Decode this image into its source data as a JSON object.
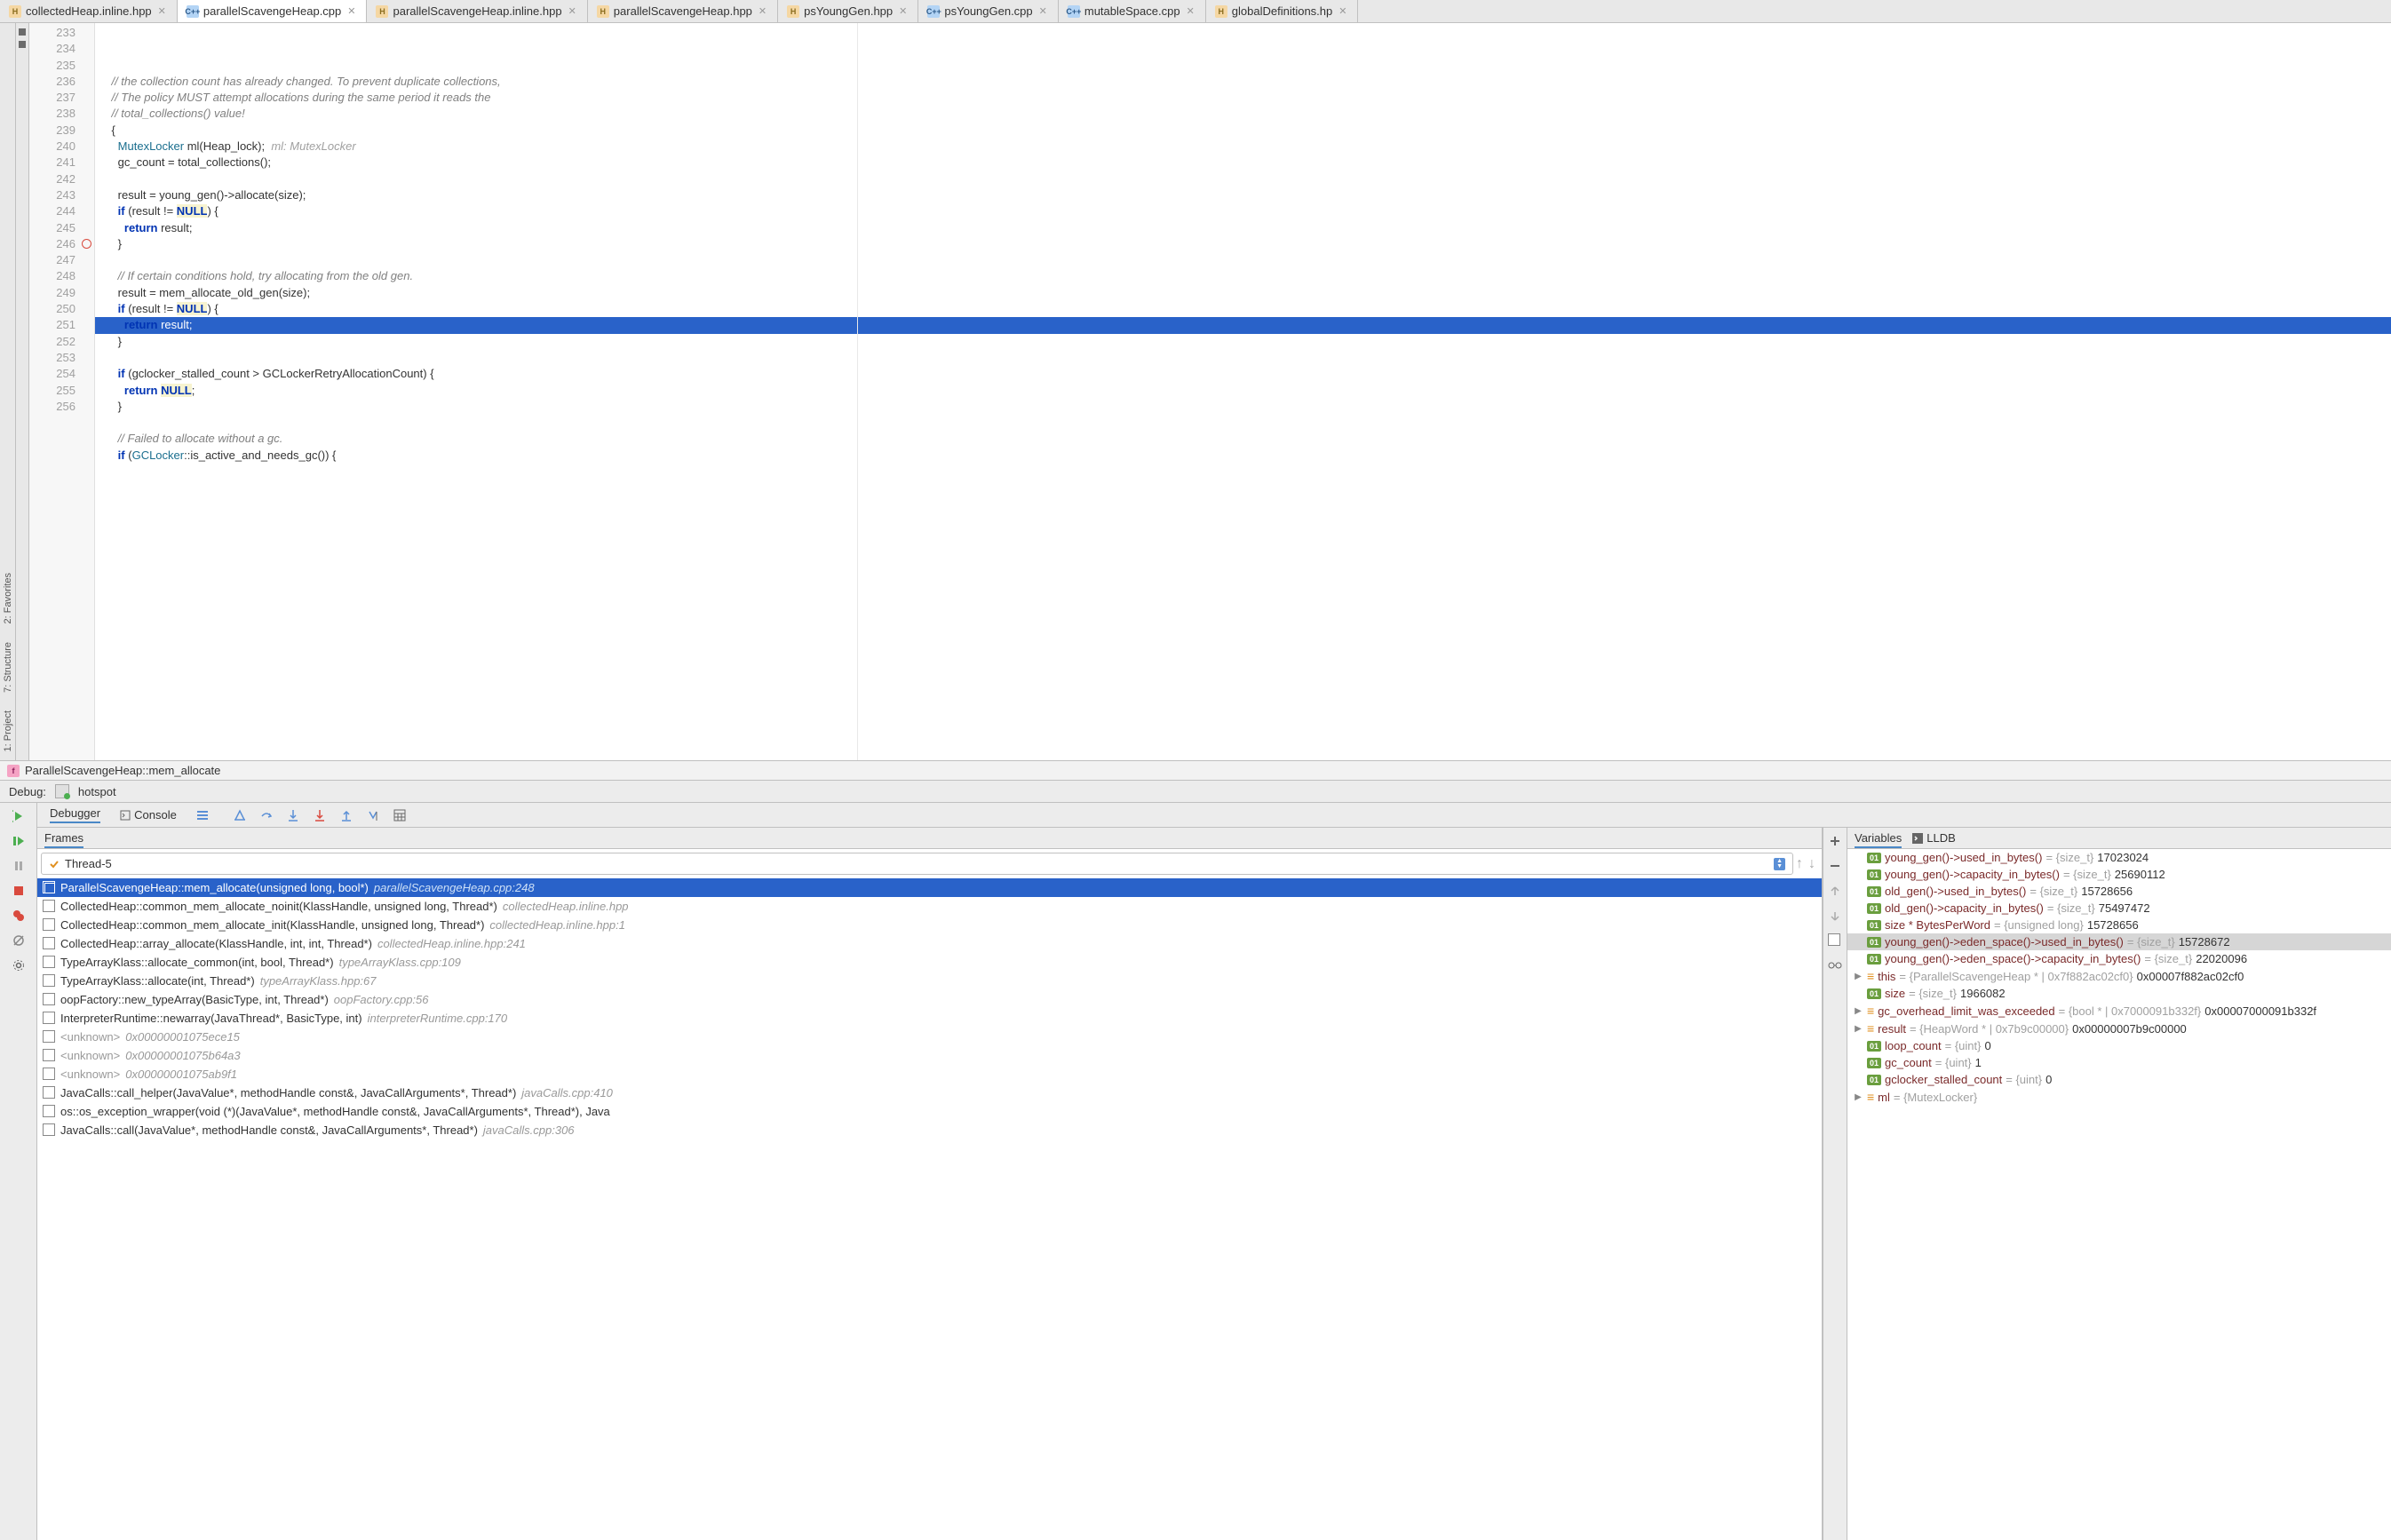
{
  "tabs": [
    {
      "name": "collectedHeap.inline.hpp",
      "kind": "h"
    },
    {
      "name": "parallelScavengeHeap.cpp",
      "kind": "cpp",
      "active": true
    },
    {
      "name": "parallelScavengeHeap.inline.hpp",
      "kind": "h"
    },
    {
      "name": "parallelScavengeHeap.hpp",
      "kind": "h"
    },
    {
      "name": "psYoungGen.hpp",
      "kind": "h"
    },
    {
      "name": "psYoungGen.cpp",
      "kind": "cpp"
    },
    {
      "name": "mutableSpace.cpp",
      "kind": "cpp"
    },
    {
      "name": "globalDefinitions.hp",
      "kind": "h"
    }
  ],
  "gutter_start": 233,
  "gutter_end": 256,
  "breakpoint_line": 246,
  "highlight_line": 248,
  "code_lines": [
    {
      "n": 233,
      "html": "    <span class='c-comment'>// the collection count has already changed. To prevent duplicate collections,</span>"
    },
    {
      "n": 234,
      "html": "    <span class='c-comment'>// The policy MUST attempt allocations during the same period it reads the</span>"
    },
    {
      "n": 235,
      "html": "    <span class='c-comment'>// total_collections() value!</span>"
    },
    {
      "n": 236,
      "html": "    {"
    },
    {
      "n": 237,
      "html": "      <span class='c-type'>MutexLocker</span> ml(Heap_lock);  <span class='c-hint'>ml: MutexLocker</span>"
    },
    {
      "n": 238,
      "html": "      gc_count = total_collections();"
    },
    {
      "n": 239,
      "html": ""
    },
    {
      "n": 240,
      "html": "      result = young_gen()-&gt;allocate(size);"
    },
    {
      "n": 241,
      "html": "      <span class='c-kw'>if</span> (result != <span class='c-null'>NULL</span>) {"
    },
    {
      "n": 242,
      "html": "        <span class='c-kw'>return</span> result;"
    },
    {
      "n": 243,
      "html": "      }"
    },
    {
      "n": 244,
      "html": ""
    },
    {
      "n": 245,
      "html": "      <span class='c-comment'>// If certain conditions hold, try allocating from the old gen.</span>"
    },
    {
      "n": 246,
      "html": "      result = mem_allocate_old_gen(size);"
    },
    {
      "n": 247,
      "html": "      <span class='c-kw'>if</span> (result != <span class='c-null'>NULL</span>) {"
    },
    {
      "n": 248,
      "html": "        <span class='c-kw'>return</span> result;"
    },
    {
      "n": 249,
      "html": "      }"
    },
    {
      "n": 250,
      "html": ""
    },
    {
      "n": 251,
      "html": "      <span class='c-kw'>if</span> (gclocker_stalled_count &gt; GCLockerRetryAllocationCount) {"
    },
    {
      "n": 252,
      "html": "        <span class='c-kw'>return</span> <span class='c-null'>NULL</span>;"
    },
    {
      "n": 253,
      "html": "      }"
    },
    {
      "n": 254,
      "html": ""
    },
    {
      "n": 255,
      "html": "      <span class='c-comment'>// Failed to allocate without a gc.</span>"
    },
    {
      "n": 256,
      "html": "      <span class='c-kw'>if</span> (<span class='c-type'>GCLocker</span>::is_active_and_needs_gc()) {"
    }
  ],
  "breadcrumb": "ParallelScavengeHeap::mem_allocate",
  "debug_label": "Debug:",
  "debug_config": "hotspot",
  "debugger_tab": "Debugger",
  "console_tab": "Console",
  "frames_label": "Frames",
  "variables_label": "Variables",
  "lldb_label": "LLDB",
  "thread": "Thread-5",
  "left_vertical": [
    "2: Favorites",
    "7: Structure",
    "1: Project"
  ],
  "frames": [
    {
      "sig": "ParallelScavengeHeap::mem_allocate(unsigned long, bool*)",
      "loc": "parallelScavengeHeap.cpp:248",
      "sel": true
    },
    {
      "sig": "CollectedHeap::common_mem_allocate_noinit(KlassHandle, unsigned long, Thread*)",
      "loc": "collectedHeap.inline.hpp"
    },
    {
      "sig": "CollectedHeap::common_mem_allocate_init(KlassHandle, unsigned long, Thread*)",
      "loc": "collectedHeap.inline.hpp:1"
    },
    {
      "sig": "CollectedHeap::array_allocate(KlassHandle, int, int, Thread*)",
      "loc": "collectedHeap.inline.hpp:241"
    },
    {
      "sig": "TypeArrayKlass::allocate_common(int, bool, Thread*)",
      "loc": "typeArrayKlass.cpp:109"
    },
    {
      "sig": "TypeArrayKlass::allocate(int, Thread*)",
      "loc": "typeArrayKlass.hpp:67"
    },
    {
      "sig": "oopFactory::new_typeArray(BasicType, int, Thread*)",
      "loc": "oopFactory.cpp:56"
    },
    {
      "sig": "InterpreterRuntime::newarray(JavaThread*, BasicType, int)",
      "loc": "interpreterRuntime.cpp:170"
    },
    {
      "sig": "<unknown>",
      "loc": "0x00000001075ece15",
      "unk": true
    },
    {
      "sig": "<unknown>",
      "loc": "0x00000001075b64a3",
      "unk": true
    },
    {
      "sig": "<unknown>",
      "loc": "0x00000001075ab9f1",
      "unk": true
    },
    {
      "sig": "JavaCalls::call_helper(JavaValue*, methodHandle const&, JavaCallArguments*, Thread*)",
      "loc": "javaCalls.cpp:410"
    },
    {
      "sig": "os::os_exception_wrapper(void (*)(JavaValue*, methodHandle const&, JavaCallArguments*, Thread*), Java",
      "loc": ""
    },
    {
      "sig": "JavaCalls::call(JavaValue*, methodHandle const&, JavaCallArguments*, Thread*)",
      "loc": "javaCalls.cpp:306"
    }
  ],
  "vars": [
    {
      "exp": "",
      "badge": "01",
      "name": "young_gen()->used_in_bytes()",
      "type": "= {size_t}",
      "val": "17023024"
    },
    {
      "exp": "",
      "badge": "01",
      "name": "young_gen()->capacity_in_bytes()",
      "type": "= {size_t}",
      "val": "25690112"
    },
    {
      "exp": "",
      "badge": "01",
      "name": "old_gen()->used_in_bytes()",
      "type": "= {size_t}",
      "val": "15728656"
    },
    {
      "exp": "",
      "badge": "01",
      "name": "old_gen()->capacity_in_bytes()",
      "type": "= {size_t}",
      "val": "75497472"
    },
    {
      "exp": "",
      "badge": "01",
      "name": "size * BytesPerWord",
      "type": "= {unsigned long}",
      "val": "15728656"
    },
    {
      "exp": "",
      "badge": "01",
      "name": "young_gen()->eden_space()->used_in_bytes()",
      "type": "= {size_t}",
      "val": "15728672",
      "sel": true
    },
    {
      "exp": "",
      "badge": "01",
      "name": "young_gen()->eden_space()->capacity_in_bytes()",
      "type": "= {size_t}",
      "val": "22020096"
    },
    {
      "exp": "▶",
      "badge": "eq",
      "name": "this",
      "type": "= {ParallelScavengeHeap * | 0x7f882ac02cf0}",
      "val": "0x00007f882ac02cf0"
    },
    {
      "exp": "",
      "badge": "01",
      "name": "size",
      "type": "= {size_t}",
      "val": "1966082"
    },
    {
      "exp": "▶",
      "badge": "eq",
      "name": "gc_overhead_limit_was_exceeded",
      "type": "= {bool * | 0x7000091b332f}",
      "val": "0x00007000091b332f"
    },
    {
      "exp": "▶",
      "badge": "eq",
      "name": "result",
      "type": "= {HeapWord * | 0x7b9c00000}",
      "val": "0x00000007b9c00000"
    },
    {
      "exp": "",
      "badge": "01",
      "name": "loop_count",
      "type": "= {uint}",
      "val": "0"
    },
    {
      "exp": "",
      "badge": "01",
      "name": "gc_count",
      "type": "= {uint}",
      "val": "1"
    },
    {
      "exp": "",
      "badge": "01",
      "name": "gclocker_stalled_count",
      "type": "= {uint}",
      "val": "0"
    },
    {
      "exp": "▶",
      "badge": "eq",
      "name": "ml",
      "type": "= {MutexLocker}",
      "val": ""
    }
  ]
}
